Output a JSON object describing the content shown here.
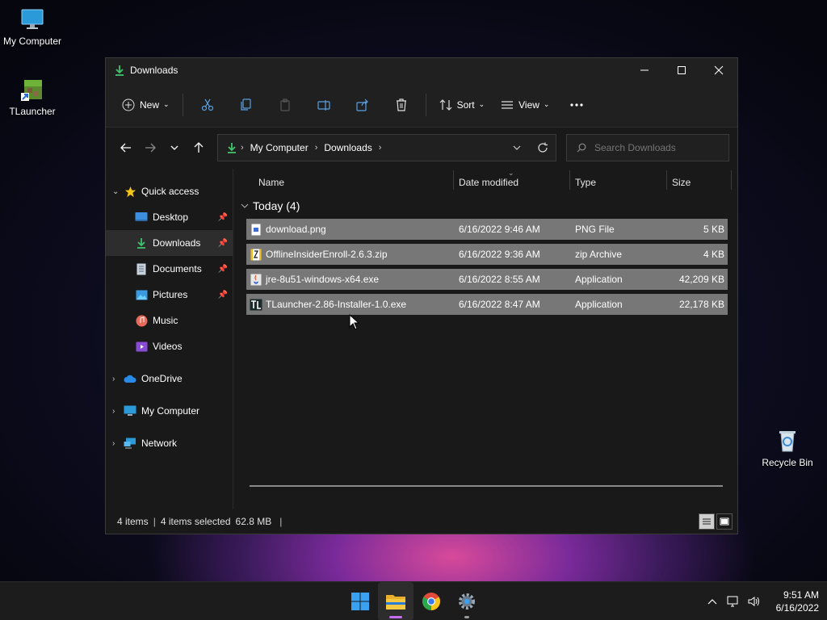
{
  "desktop": {
    "icons": [
      {
        "label": "My Computer",
        "icon": "monitor-icon"
      },
      {
        "label": "TLauncher",
        "icon": "tlauncher-icon"
      },
      {
        "label": "Recycle Bin",
        "icon": "recycle-bin-icon"
      }
    ]
  },
  "window": {
    "title": "Downloads",
    "toolbar": {
      "new_label": "New",
      "sort_label": "Sort",
      "view_label": "View"
    },
    "address": {
      "crumbs": [
        "My Computer",
        "Downloads"
      ]
    },
    "search": {
      "placeholder": "Search Downloads"
    },
    "sidebar": {
      "items": [
        {
          "label": "Quick access",
          "icon": "star-icon"
        },
        {
          "label": "Desktop",
          "icon": "desktop-icon",
          "pinned": true
        },
        {
          "label": "Downloads",
          "icon": "download-icon",
          "pinned": true,
          "active": true
        },
        {
          "label": "Documents",
          "icon": "documents-icon",
          "pinned": true
        },
        {
          "label": "Pictures",
          "icon": "pictures-icon",
          "pinned": true
        },
        {
          "label": "Music",
          "icon": "music-icon"
        },
        {
          "label": "Videos",
          "icon": "videos-icon"
        },
        {
          "label": "OneDrive",
          "icon": "cloud-icon"
        },
        {
          "label": "My Computer",
          "icon": "monitor-icon"
        },
        {
          "label": "Network",
          "icon": "network-icon"
        }
      ]
    },
    "columns": {
      "name": "Name",
      "date": "Date modified",
      "type": "Type",
      "size": "Size"
    },
    "group": {
      "label": "Today (4)"
    },
    "files": [
      {
        "name": "download.png",
        "date": "6/16/2022 9:46 AM",
        "type": "PNG File",
        "size": "5 KB",
        "icon": "png-file-icon"
      },
      {
        "name": "OfflineInsiderEnroll-2.6.3.zip",
        "date": "6/16/2022 9:36 AM",
        "type": "zip Archive",
        "size": "4 KB",
        "icon": "zip-file-icon"
      },
      {
        "name": "jre-8u51-windows-x64.exe",
        "date": "6/16/2022 8:55 AM",
        "type": "Application",
        "size": "42,209 KB",
        "icon": "java-icon"
      },
      {
        "name": "TLauncher-2.86-Installer-1.0.exe",
        "date": "6/16/2022 8:47 AM",
        "type": "Application",
        "size": "22,178 KB",
        "icon": "tlauncher-icon"
      }
    ],
    "status": {
      "items": "4 items",
      "selected": "4 items selected",
      "size": "62.8 MB",
      "sep": "|"
    }
  },
  "taskbar": {
    "apps": [
      {
        "name": "start",
        "icon": "windows-icon"
      },
      {
        "name": "file-explorer",
        "icon": "folder-icon"
      },
      {
        "name": "chrome",
        "icon": "chrome-icon"
      },
      {
        "name": "settings",
        "icon": "gear-icon"
      }
    ],
    "clock": {
      "time": "9:51 AM",
      "date": "6/16/2022"
    }
  }
}
